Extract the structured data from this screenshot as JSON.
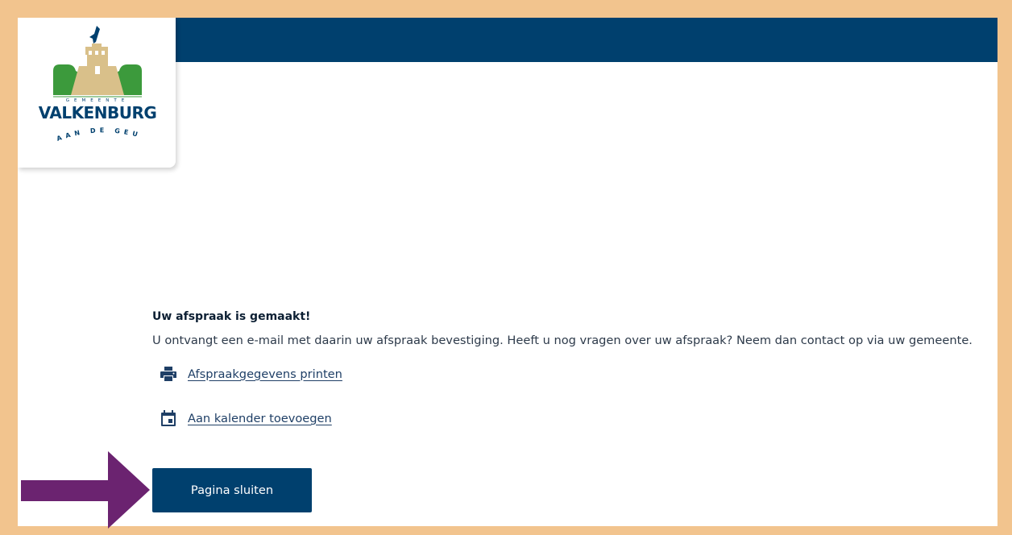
{
  "brand": {
    "logo_top_text": "GEMEENTE",
    "logo_name": "VALKENBURG",
    "logo_bottom_text": "AAN DE GEUL",
    "colors": {
      "navy": "#00406e",
      "green": "#3c9a3c",
      "tan": "#d9c08a",
      "frame": "#f2c48e",
      "arrow": "#6b2370"
    }
  },
  "confirmation": {
    "title": "Uw afspraak is gemaakt!",
    "message": "U ontvangt een e-mail met daarin uw afspraak bevestiging. Heeft u nog vragen over uw afspraak? Neem dan contact op via uw gemeente."
  },
  "actions": {
    "print": {
      "label": "Afspraakgegevens printen",
      "icon": "printer-icon"
    },
    "calendar": {
      "label": "Aan kalender toevoegen",
      "icon": "calendar-icon"
    }
  },
  "close_button": {
    "label": "Pagina sluiten"
  },
  "annotation": {
    "icon": "arrow-right-icon"
  }
}
